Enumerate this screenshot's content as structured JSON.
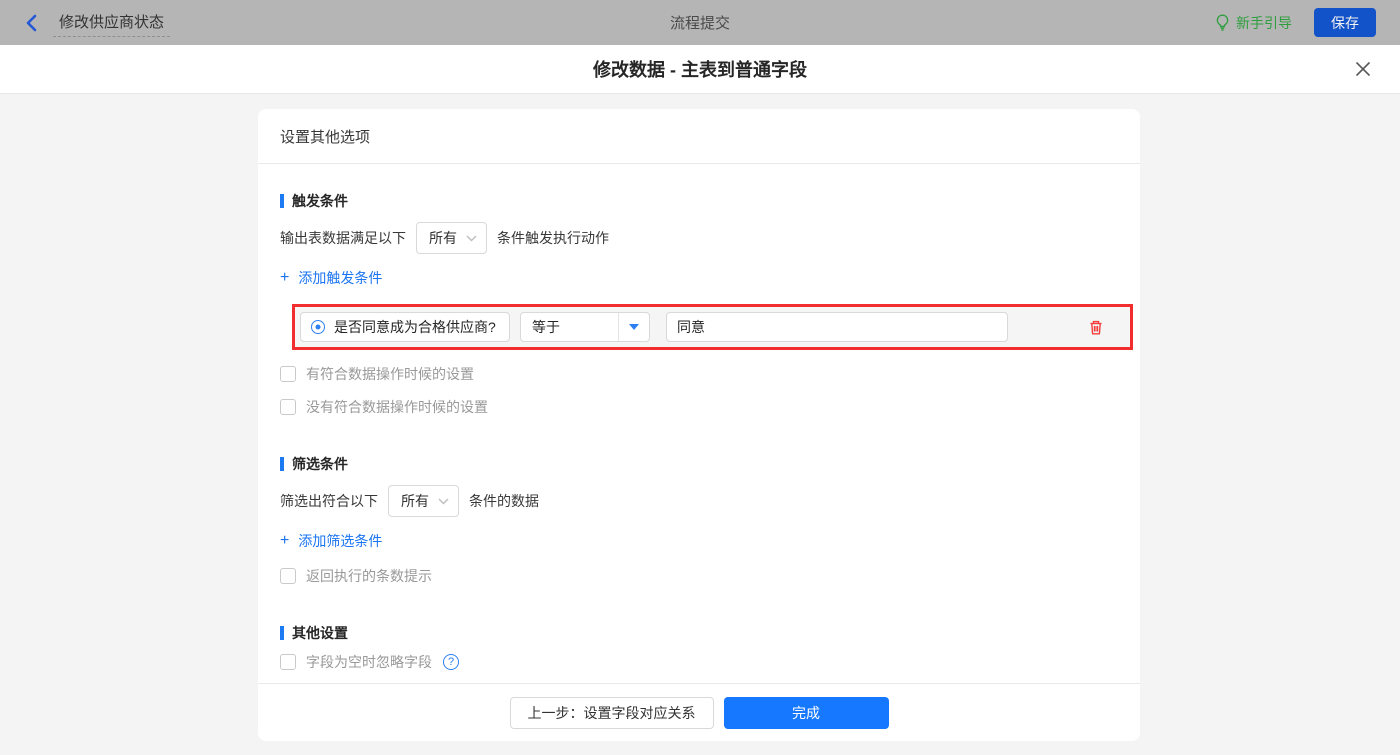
{
  "topbar": {
    "flow_name": "修改供应商状态",
    "center_title": "流程提交",
    "guide_label": "新手引导",
    "save_label": "保存"
  },
  "modal": {
    "title": "修改数据 - 主表到普通字段"
  },
  "panel": {
    "title": "设置其他选项",
    "trigger": {
      "heading": "触发条件",
      "sentence_prefix": "输出表数据满足以下",
      "select_value": "所有",
      "sentence_suffix": "条件触发执行动作",
      "plus": "+",
      "add_label": "添加触发条件",
      "condition": {
        "field_label": "是否同意成为合格供应商?",
        "operator_value": "等于",
        "value_text": "同意"
      },
      "checkbox_match_label": "有符合数据操作时候的设置",
      "checkbox_no_match_label": "没有符合数据操作时候的设置"
    },
    "filter": {
      "heading": "筛选条件",
      "sentence_prefix": "筛选出符合以下",
      "select_value": "所有",
      "sentence_suffix": "条件的数据",
      "plus": "+",
      "add_label": "添加筛选条件",
      "checkbox_count_label": "返回执行的条数提示"
    },
    "other": {
      "heading": "其他设置",
      "checkbox_ignore_label": "字段为空时忽略字段",
      "help_glyph": "?"
    },
    "footer": {
      "prev_label": "上一步：设置字段对应关系",
      "done_label": "完成"
    }
  },
  "colors": {
    "accent_blue": "#1c7af2",
    "primary_button_blue": "#1677ff",
    "highlight_red": "#f22d2d",
    "guide_green": "#2f9e3e",
    "topbar_dimmed_gray": "#b5b5b5"
  }
}
